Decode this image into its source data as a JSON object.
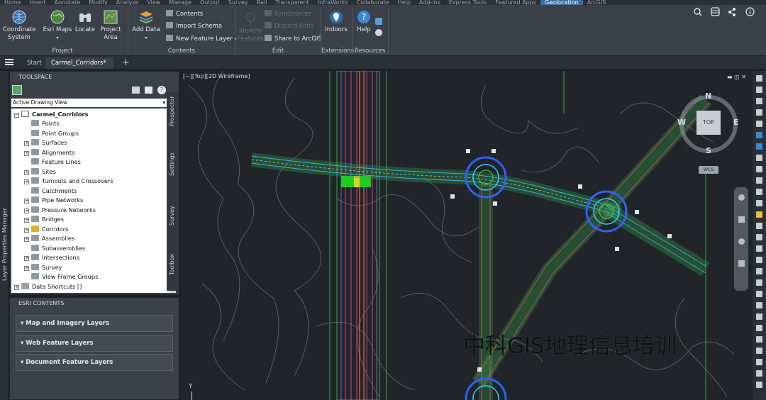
{
  "menu": [
    "Home",
    "Insert",
    "Annotate",
    "Modify",
    "Analyze",
    "View",
    "Manage",
    "Output",
    "Survey",
    "Rail",
    "Transparent",
    "InfraWorks",
    "Collaborate",
    "Help",
    "Add-ins",
    "Express Tools",
    "Featured Apps",
    "Geolocation",
    "ArcGIS"
  ],
  "menu_active": "Geolocation",
  "ribbon": {
    "project": {
      "coordinate_system": "Coordinate\nSystem",
      "esri_maps": "Esri Maps",
      "locate": "Locate",
      "project_area": "Project\nArea",
      "label": "Project"
    },
    "contents": {
      "add_data": "Add Data",
      "contents": "Contents",
      "import_schema": "Import Schema",
      "new_feature_layer": "New Feature Layer",
      "label": "Contents"
    },
    "edit": {
      "identify_features": "Identify\nFeatures",
      "synchronize": "Synchronize",
      "discard_edits": "Discard Edits",
      "share_arcgis": "Share to ArcGIS",
      "label": "Edit"
    },
    "extensions": {
      "indoors": "Indoors",
      "label": "Extensions"
    },
    "resources": {
      "help": "Help",
      "label": "Resources"
    }
  },
  "tabs": {
    "start": "Start",
    "active": "Carmel_Corridors*",
    "add": "+"
  },
  "layer_properties_manager": "Layer Properties Manager",
  "toolspace": {
    "title": "TOOLSPACE",
    "view_select": "Active Drawing View",
    "root": "Carmel_Corridors",
    "items": [
      "Points",
      "Point Groups",
      "Surfaces",
      "Alignments",
      "Feature Lines",
      "Sites",
      "Turnouts and Crossovers",
      "Catchments",
      "Pipe Networks",
      "Pressure Networks",
      "Bridges",
      "Corridors",
      "Assemblies",
      "Subassemblies",
      "Intersections",
      "Survey",
      "View Frame Groups"
    ],
    "shortcuts": "Data Shortcuts []",
    "side_tabs": [
      "Prospector",
      "Settings",
      "Survey",
      "Toolbox"
    ]
  },
  "esri_contents": {
    "title": "ESRI CONTENTS",
    "sections": [
      "Map and Imagery Layers",
      "Web Feature Layers",
      "Document Feature Layers"
    ]
  },
  "viewport": {
    "label": "[−][Top][2D Wireframe]",
    "compass": {
      "n": "N",
      "s": "S",
      "e": "E",
      "w": "W",
      "top": "TOP",
      "wcs": "WCS"
    },
    "y_axis": "Y"
  },
  "watermark": "中科GIS地理信息培训",
  "colors": {
    "ribbon_bg": "#3b4049",
    "cad_bg": "#212428",
    "accent": "#3d6c9e"
  }
}
